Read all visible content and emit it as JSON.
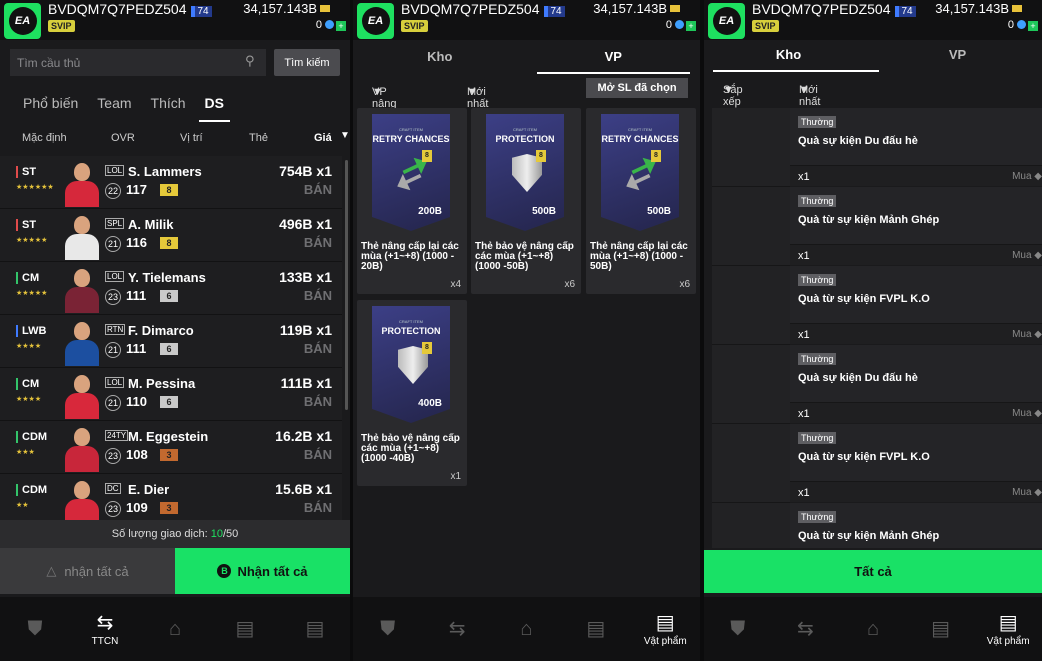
{
  "header": {
    "username": "BVDQM7Q7PEDZ504",
    "level": "74",
    "vip": "SVIP",
    "coins": "34,157.143B",
    "gems": "0",
    "logo": "EA"
  },
  "panel1": {
    "search_placeholder": "Tìm cầu thủ",
    "search_button": "Tìm kiếm",
    "tabs": [
      "Phổ biến",
      "Team",
      "Thích",
      "DS"
    ],
    "sort": [
      "Mặc định",
      "OVR",
      "Vị trí",
      "Thẻ",
      "Giá"
    ],
    "players": [
      {
        "pos": "ST",
        "pos_color": "#e04b4b",
        "stars": "★★★★★★",
        "season": "LOL",
        "name": "S. Lammers",
        "ovr_circle": "22",
        "ovr": "117",
        "upg": "8",
        "upg_color": "#e5c93a",
        "price": "754B x1",
        "sell": "BÁN",
        "kit": "#d6283b"
      },
      {
        "pos": "ST",
        "pos_color": "#e04b4b",
        "stars": "★★★★★",
        "season": "SPL",
        "name": "A. Milik",
        "ovr_circle": "21",
        "ovr": "116",
        "upg": "8",
        "upg_color": "#e5c93a",
        "price": "496B x1",
        "sell": "BÁN",
        "kit": "#e8e8e8"
      },
      {
        "pos": "CM",
        "pos_color": "#33c46a",
        "stars": "★★★★★",
        "season": "LOL",
        "name": "Y. Tielemans",
        "ovr_circle": "23",
        "ovr": "111",
        "upg": "6",
        "upg_color": "#c9c9c9",
        "price": "133B x1",
        "sell": "BÁN",
        "kit": "#7a2335"
      },
      {
        "pos": "LWB",
        "pos_color": "#3f7bff",
        "stars": "★★★★",
        "season": "RTN",
        "name": "F. Dimarco",
        "ovr_circle": "21",
        "ovr": "111",
        "upg": "6",
        "upg_color": "#c9c9c9",
        "price": "119B x1",
        "sell": "BÁN",
        "kit": "#1c4fa0"
      },
      {
        "pos": "CM",
        "pos_color": "#33c46a",
        "stars": "★★★★",
        "season": "LOL",
        "name": "M. Pessina",
        "ovr_circle": "21",
        "ovr": "110",
        "upg": "6",
        "upg_color": "#c9c9c9",
        "price": "111B x1",
        "sell": "BÁN",
        "kit": "#d8283b"
      },
      {
        "pos": "CDM",
        "pos_color": "#33c46a",
        "stars": "★★★",
        "season": "24TY",
        "name": "M. Eggestein",
        "ovr_circle": "23",
        "ovr": "108",
        "upg": "3",
        "upg_color": "#c2692f",
        "price": "16.2B x1",
        "sell": "BÁN",
        "kit": "#c8263a"
      },
      {
        "pos": "CDM",
        "pos_color": "#33c46a",
        "stars": "★★",
        "season": "DC",
        "name": "E. Dier",
        "ovr_circle": "23",
        "ovr": "109",
        "upg": "3",
        "upg_color": "#c2692f",
        "price": "15.6B x1",
        "sell": "BÁN",
        "kit": "#d6283b"
      }
    ],
    "trade_label": "Số lượng giao dịch: ",
    "trade_count": "10",
    "trade_max": "/50",
    "btn_collect": "nhận tất cả",
    "btn_collect_all": "Nhận tất cả",
    "nav_label": "TTCN"
  },
  "panel2": {
    "tabs": [
      "Kho",
      "VP"
    ],
    "filter_upgrade": "VP nâng cấp",
    "filter_newest": "Mới nhất",
    "open_button": "Mở SL đã chọn",
    "cards": [
      {
        "craft": "CRAFT ITEM",
        "title": "RETRY CHANCES",
        "type": "retry",
        "value": "200B",
        "desc": "Thẻ nâng cấp lại các mùa (+1~+8) (1000 - 20B)",
        "qty": "x4"
      },
      {
        "craft": "CRAFT ITEM",
        "title": "PROTECTION",
        "type": "protect",
        "value": "500B",
        "desc": "Thẻ bảo vệ nâng cấp các mùa (+1~+8) (1000 -50B)",
        "qty": "x6"
      },
      {
        "craft": "CRAFT ITEM",
        "title": "RETRY CHANCES",
        "type": "retry",
        "value": "500B",
        "desc": "Thẻ nâng cấp lại các mùa (+1~+8) (1000 - 50B)",
        "qty": "x6"
      },
      {
        "craft": "CRAFT ITEM",
        "title": "PROTECTION",
        "type": "protect",
        "value": "400B",
        "desc": "Thẻ bảo vệ nâng cấp các mùa (+1~+8) (1000 -40B)",
        "qty": "x1"
      }
    ],
    "nav_label": "Vật phẩm"
  },
  "panel3": {
    "tabs": [
      "Kho",
      "VP"
    ],
    "filter_sort": "Sắp xếp",
    "filter_newest": "Mới nhất",
    "items": [
      {
        "rarity": "Thường",
        "name": "Quà sự kiện Du đấu hè",
        "qty": "x1",
        "buy": "Mua"
      },
      {
        "rarity": "Thường",
        "name": "Quà từ sự kiện Mảnh Ghép",
        "qty": "x1",
        "buy": "Mua"
      },
      {
        "rarity": "Thường",
        "name": "Quà từ sự kiện FVPL K.O",
        "qty": "x1",
        "buy": "Mua"
      },
      {
        "rarity": "Thường",
        "name": "Quà sự kiện Du đấu hè",
        "qty": "x1",
        "buy": "Mua"
      },
      {
        "rarity": "Thường",
        "name": "Quà từ sự kiện FVPL K.O",
        "qty": "x1",
        "buy": "Mua"
      },
      {
        "rarity": "Thường",
        "name": "Quà từ sự kiện Mảnh Ghép",
        "qty": "",
        "buy": ""
      }
    ],
    "btn_all": "Tất cả",
    "nav_label": "Vật phẩm"
  },
  "icons": {
    "cart": "cart-icon",
    "transfer": "transfer-icon",
    "home": "home-icon",
    "field": "field-icon",
    "items": "items-icon"
  }
}
